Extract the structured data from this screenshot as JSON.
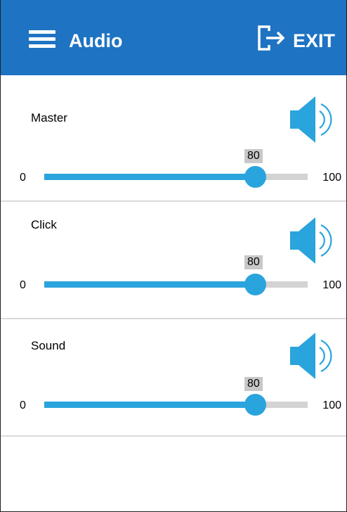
{
  "header": {
    "title": "Audio",
    "exit_label": "EXIT",
    "background": "#1e73c2",
    "menu_icon": "hamburger-menu-icon",
    "exit_icon": "logout-icon"
  },
  "accent_color": "#2aa4dc",
  "sliders": [
    {
      "label": "Master",
      "min": "0",
      "max": "100",
      "value": "80",
      "icon": "speaker-volume-icon"
    },
    {
      "label": "Click",
      "min": "0",
      "max": "100",
      "value": "80",
      "icon": "speaker-volume-icon"
    },
    {
      "label": "Sound",
      "min": "0",
      "max": "100",
      "value": "80",
      "icon": "speaker-volume-icon"
    }
  ]
}
